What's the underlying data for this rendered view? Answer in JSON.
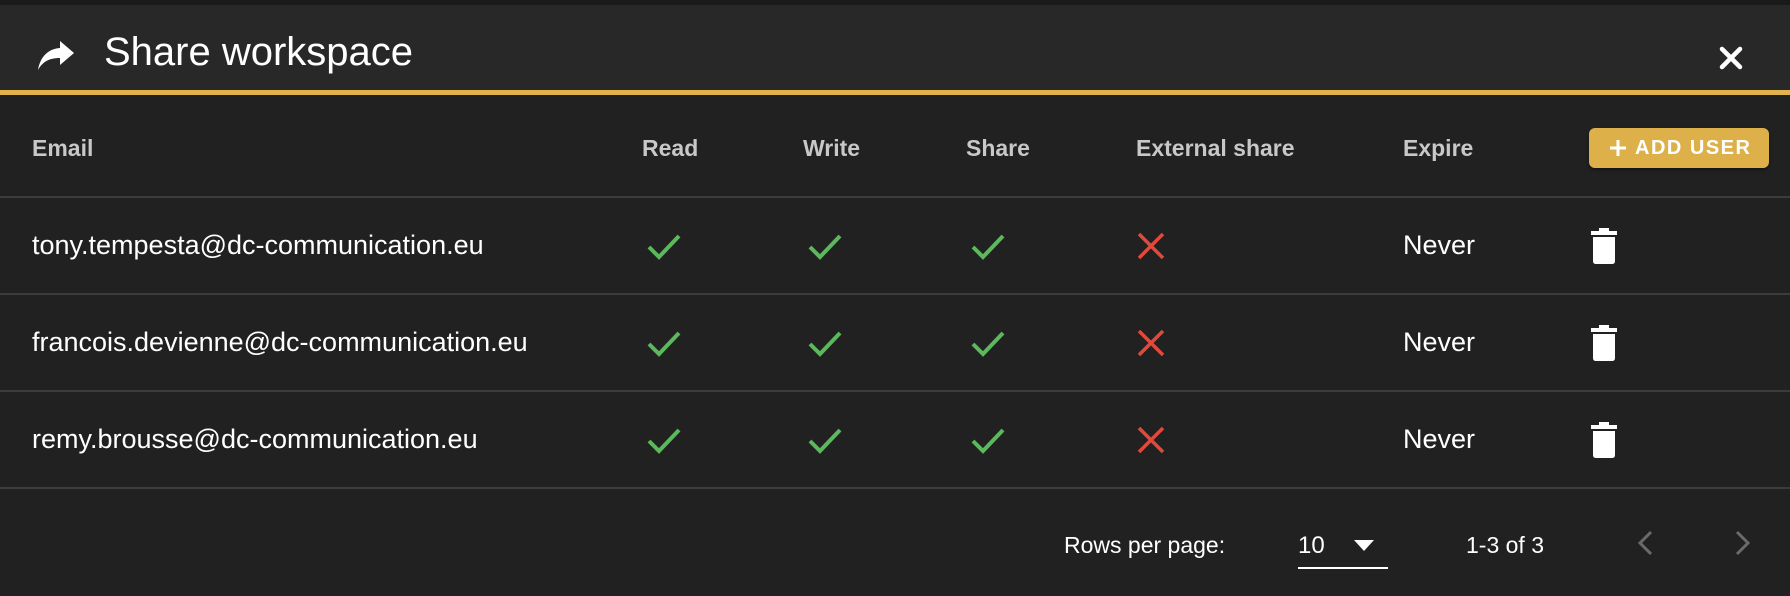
{
  "dialog": {
    "title": "Share workspace",
    "title_icon": "share-arrow-icon",
    "close_icon": "close-icon",
    "accent_color": "#e2b34a"
  },
  "table": {
    "columns": [
      "Email",
      "Read",
      "Write",
      "Share",
      "External share",
      "Expire"
    ],
    "add_user_label": "ADD USER",
    "rows": [
      {
        "email": "tony.tempesta@dc-communication.eu",
        "read": true,
        "write": true,
        "share": true,
        "external_share": false,
        "expire": "Never"
      },
      {
        "email": "francois.devienne@dc-communication.eu",
        "read": true,
        "write": true,
        "share": true,
        "external_share": false,
        "expire": "Never"
      },
      {
        "email": "remy.brousse@dc-communication.eu",
        "read": true,
        "write": true,
        "share": true,
        "external_share": false,
        "expire": "Never"
      }
    ]
  },
  "pagination": {
    "rows_per_page_label": "Rows per page:",
    "rows_per_page_value": "10",
    "range_text": "1-3 of 3"
  },
  "colors": {
    "check": "#5cb85c",
    "cross": "#e0493c",
    "background": "#212121",
    "header": "#282828"
  }
}
